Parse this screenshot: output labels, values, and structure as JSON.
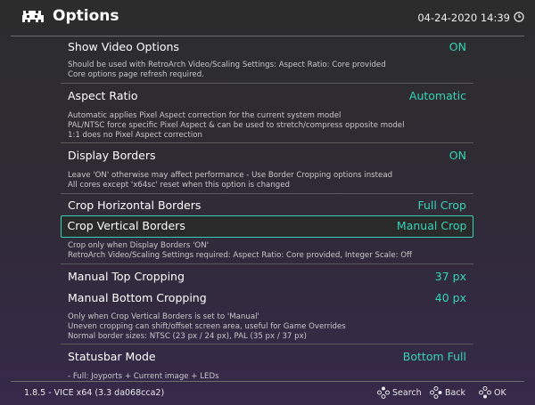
{
  "header": {
    "title": "Options",
    "datetime": "04-24-2020 14:39"
  },
  "items": [
    {
      "label": "Show Video Options",
      "value": "ON",
      "desc": [
        "Should be used with RetroArch Video/Scaling Settings: Aspect Ratio: Core provided",
        "Core options page refresh required."
      ]
    },
    {
      "label": "Aspect Ratio",
      "value": "Automatic",
      "desc": [
        "Automatic applies Pixel Aspect correction for the current system model",
        "PAL/NTSC force specific Pixel Aspect & can be used to stretch/compress opposite model",
        "1:1 does no Pixel Aspect correction"
      ]
    },
    {
      "label": "Display Borders",
      "value": "ON",
      "desc": [
        "Leave 'ON' otherwise may affect performance - Use Border Cropping options instead",
        "All cores except 'x64sc' reset when this option is changed"
      ]
    },
    {
      "label": "Crop Horizontal Borders",
      "value": "Full Crop"
    },
    {
      "label": "Crop Vertical Borders",
      "value": "Manual Crop",
      "selected": true,
      "desc": [
        "Crop only when Display Borders 'ON'",
        "RetroArch Video/Scaling Settings required: Aspect Ratio: Core provided, Integer Scale: Off"
      ]
    },
    {
      "label": "Manual Top Cropping",
      "value": "37 px"
    },
    {
      "label": "Manual Bottom Cropping",
      "value": "40 px",
      "desc": [
        "Only when Crop Vertical Borders is set to 'Manual'",
        "Uneven cropping can shift/offset screen area, useful for Game Overrides",
        "Normal border sizes: NTSC (23 px / 24 px), PAL (35 px / 37 px)"
      ]
    },
    {
      "label": "Statusbar Mode",
      "value": "Bottom Full",
      "desc": [
        "- Full: Joyports + Current image + LEDs"
      ]
    }
  ],
  "footer": {
    "version": "1.8.5 - VICE x64 (3.3 da068cca2)",
    "search_label": "Search",
    "back_label": "Back",
    "ok_label": "OK"
  },
  "colors": {
    "accent": "#35d4b8",
    "text": "#ffffff",
    "desc": "#c8c8c8"
  },
  "icons": {
    "logo": "retroarch-invader-icon",
    "clock": "clock-icon",
    "gamepad": "gamepad-buttons-icon"
  }
}
